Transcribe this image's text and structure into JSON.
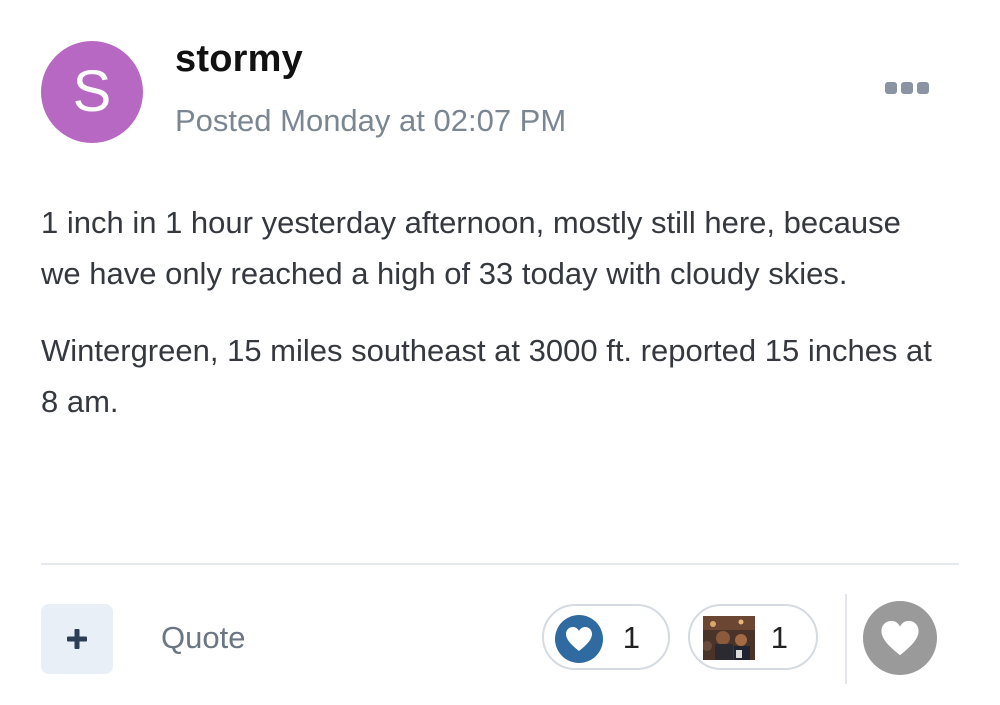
{
  "post": {
    "author": {
      "avatar_letter": "S",
      "avatar_color": "#b768c3",
      "name": "stormy"
    },
    "posted": "Posted Monday at 02:07 PM",
    "more_icon": "ellipsis-icon",
    "body": [
      "1 inch in 1 hour yesterday afternoon, mostly still here, because we have only reached a high of 33 today with cloudy skies.",
      "Wintergreen, 15 miles southeast at 3000 ft. reported 15 inches at 8 am."
    ]
  },
  "footer": {
    "plus_icon": "plus-icon",
    "quote_label": "Quote",
    "reactions": [
      {
        "icon": "like-heart-icon",
        "count": "1",
        "color": "#2f6aa1"
      },
      {
        "icon": "photo-reaction-icon",
        "count": "1"
      }
    ],
    "react_icon": "heart-icon",
    "react_color": "#9a9a9a"
  }
}
